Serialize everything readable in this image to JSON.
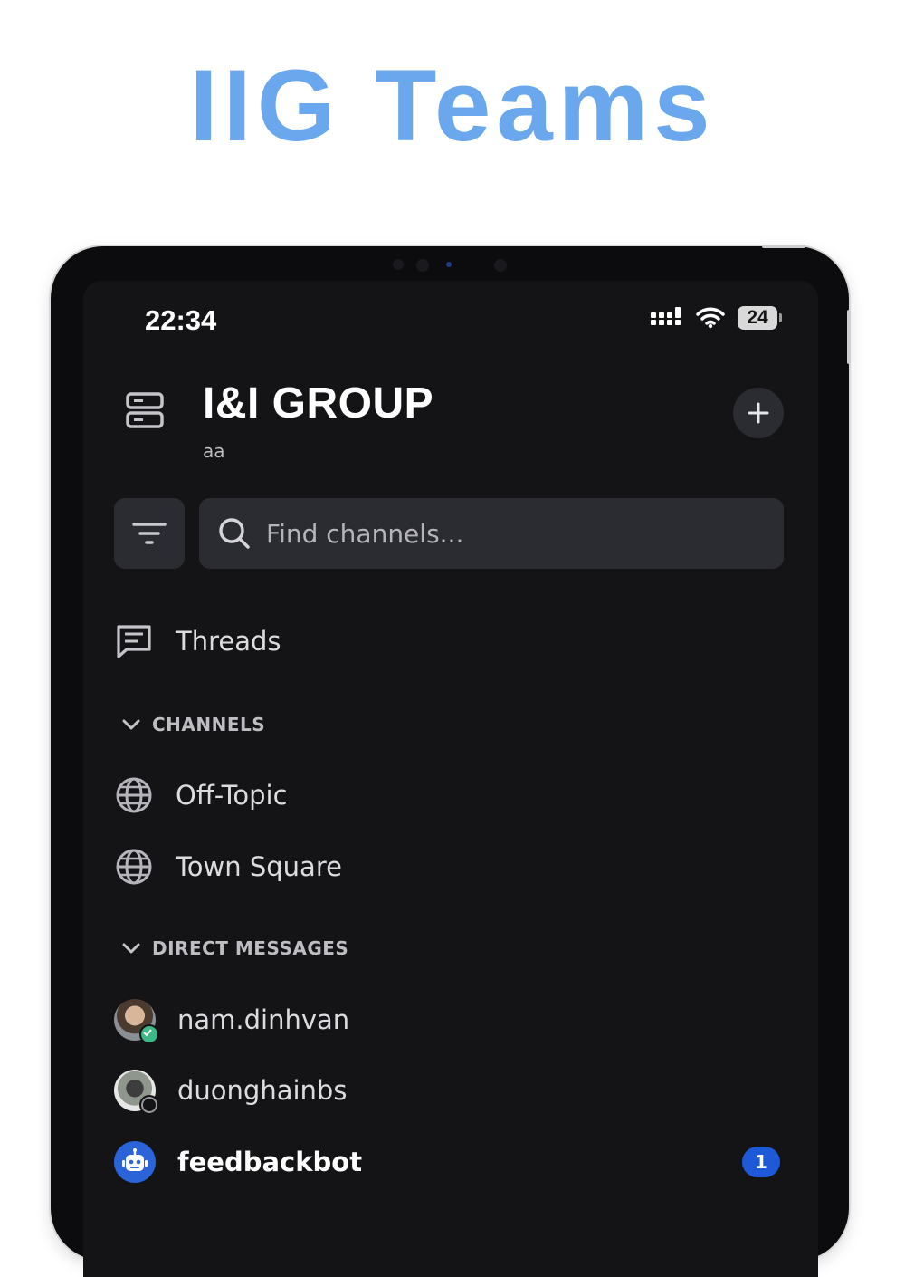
{
  "promo": {
    "title": "IIG Teams"
  },
  "status_bar": {
    "time": "22:34",
    "battery": "24"
  },
  "header": {
    "team_name": "I&I GROUP",
    "team_subtitle": "aa"
  },
  "search": {
    "placeholder": "Find channels..."
  },
  "threads": {
    "label": "Threads"
  },
  "channels": {
    "header": "CHANNELS",
    "items": [
      {
        "label": "Off-Topic",
        "icon": "globe-icon"
      },
      {
        "label": "Town Square",
        "icon": "globe-icon"
      }
    ]
  },
  "direct_messages": {
    "header": "DIRECT MESSAGES",
    "items": [
      {
        "label": "nam.dinhvan",
        "status": "online"
      },
      {
        "label": "duonghainbs",
        "status": "offline"
      },
      {
        "label": "feedbackbot",
        "unread": "1"
      }
    ]
  },
  "colors": {
    "promo_title": "#6aa7ec",
    "background": "#141417",
    "online": "#3db887",
    "badge": "#1e5ad8",
    "bot_avatar": "#2b63d9"
  }
}
